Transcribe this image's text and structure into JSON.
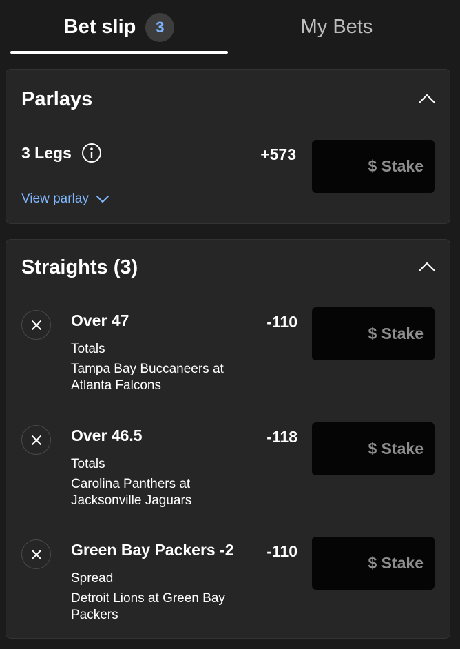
{
  "tabs": {
    "betslip": {
      "label": "Bet slip",
      "count": "3"
    },
    "mybets": {
      "label": "My Bets"
    }
  },
  "parlays": {
    "title": "Parlays",
    "legs_label": "3 Legs",
    "odds": "+573",
    "stake_placeholder": "$ Stake",
    "view_link": "View parlay"
  },
  "straights": {
    "title": "Straights (3)",
    "bets": [
      {
        "selection": "Over 47",
        "market": "Totals",
        "event": "Tampa Bay Buccaneers at Atlanta Falcons",
        "odds": "-110",
        "stake_placeholder": "$ Stake"
      },
      {
        "selection": "Over 46.5",
        "market": "Totals",
        "event": "Carolina Panthers at Jacksonville Jaguars",
        "odds": "-118",
        "stake_placeholder": "$ Stake"
      },
      {
        "selection": "Green Bay Packers -2",
        "market": "Spread",
        "event": "Detroit Lions at Green Bay Packers",
        "odds": "-110",
        "stake_placeholder": "$ Stake"
      }
    ]
  },
  "icons": {
    "collapse": "chevron-up-icon",
    "info": "info-icon",
    "expand": "chevron-down-icon",
    "remove": "close-icon"
  },
  "colors": {
    "background": "#1b1b1b",
    "card": "#262626",
    "stake_field": "#050505",
    "link": "#80b7ff",
    "badge_text": "#7cb4ff"
  }
}
